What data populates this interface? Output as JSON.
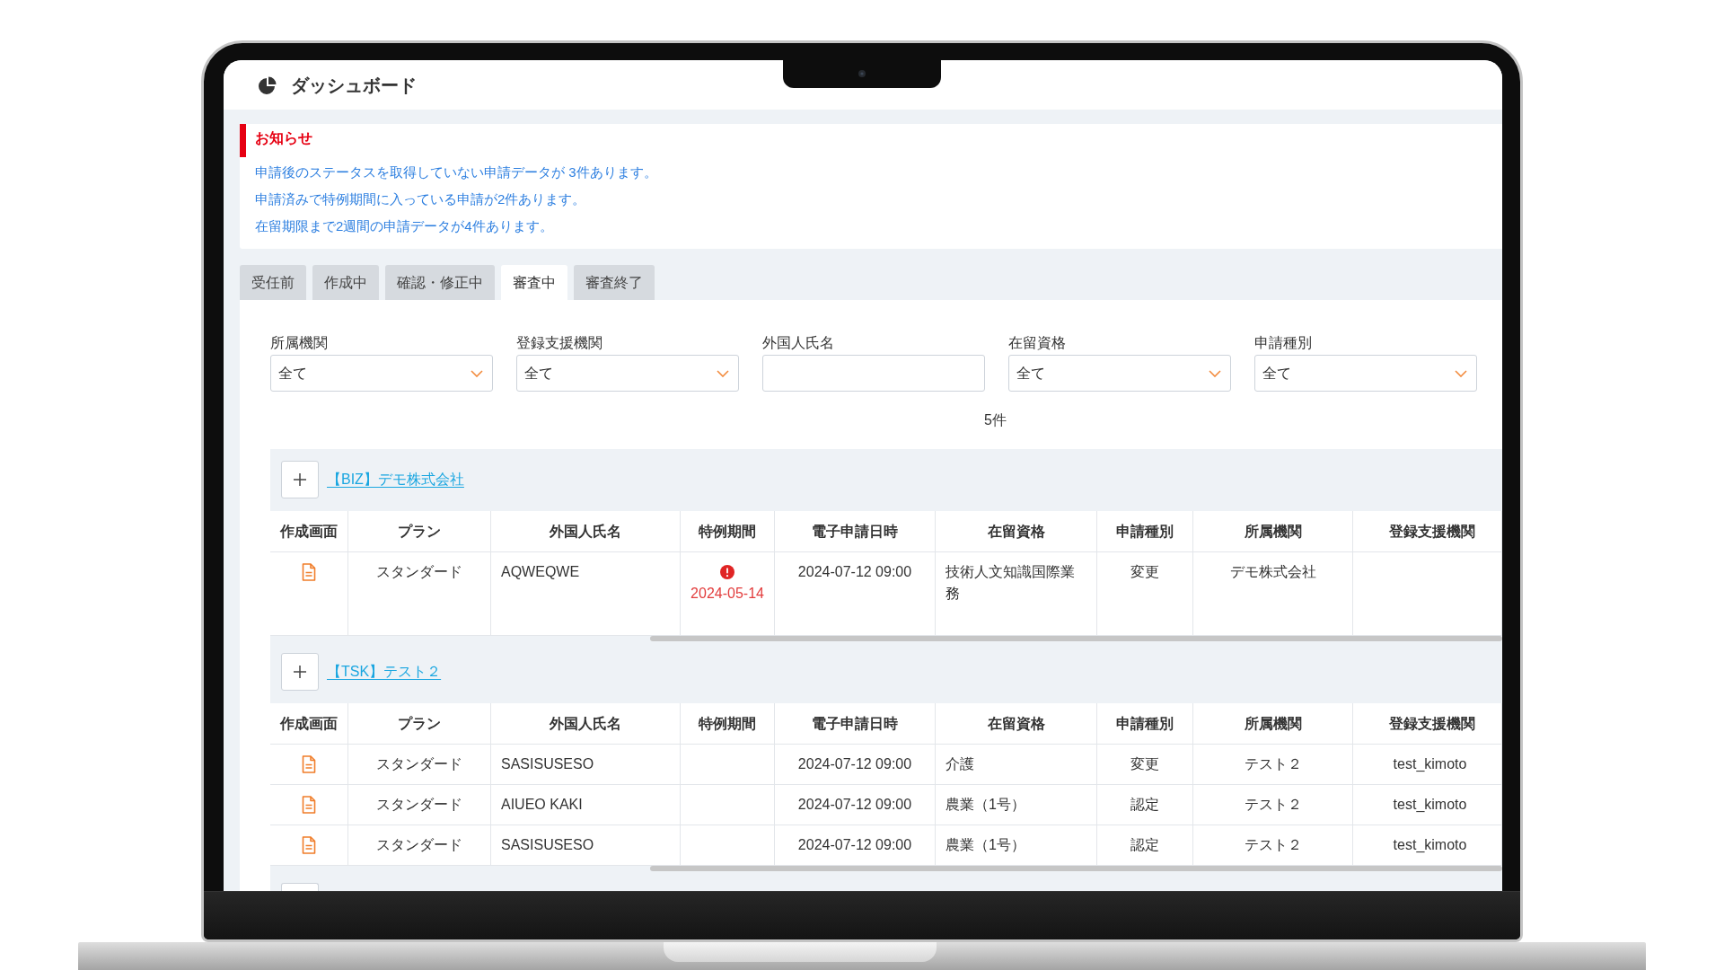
{
  "header": {
    "title": "ダッシュボード"
  },
  "notice": {
    "title": "お知らせ",
    "messages": [
      "申請後のステータスを取得していない申請データが 3件あります。",
      "申請済みで特例期間に入っている申請が2件あります。",
      "在留期限まで2週間の申請データが4件あります。"
    ]
  },
  "tabs": [
    {
      "label": "受任前",
      "selected": false
    },
    {
      "label": "作成中",
      "selected": false
    },
    {
      "label": "確認・修正中",
      "selected": false
    },
    {
      "label": "審査中",
      "selected": true
    },
    {
      "label": "審査終了",
      "selected": false
    }
  ],
  "filters": [
    {
      "kind": "select",
      "label": "所属機関",
      "value": "全て"
    },
    {
      "kind": "select",
      "label": "登録支援機関",
      "value": "全て"
    },
    {
      "kind": "text",
      "label": "外国人氏名"
    },
    {
      "kind": "select",
      "label": "在留資格",
      "value": "全て"
    },
    {
      "kind": "select",
      "label": "申請種別",
      "value": "全て"
    }
  ],
  "result_count": "5件",
  "groups": [
    {
      "title": "【BIZ】デモ株式会社",
      "columns": [
        "作成画面",
        "プラン",
        "外国人氏名",
        "特例期間",
        "電子申請日時",
        "在留資格",
        "申請種別",
        "所属機関",
        "登録支援機関"
      ],
      "rows": [
        {
          "plan": "スタンダード",
          "name": "AQWEQWE",
          "special_period": "2024-05-14",
          "submitted_at": "2024-07-12 09:00",
          "status": "技術人文知識国際業務",
          "application_type": "変更",
          "organization": "デモ株式会社"
        }
      ]
    },
    {
      "title": "【TSK】テスト２",
      "columns": [
        "作成画面",
        "プラン",
        "外国人氏名",
        "特例期間",
        "電子申請日時",
        "在留資格",
        "申請種別",
        "所属機関",
        "登録支援機関"
      ],
      "rows": [
        {
          "plan": "スタンダード",
          "name": "SASISUSESO",
          "submitted_at": "2024-07-12 09:00",
          "status": "介護",
          "application_type": "変更",
          "organization": "テスト２",
          "support_org": "test_kimoto"
        },
        {
          "plan": "スタンダード",
          "name": "AIUEO KAKI",
          "submitted_at": "2024-07-12 09:00",
          "status": "農業（1号）",
          "application_type": "認定",
          "organization": "テスト２",
          "support_org": "test_kimoto"
        },
        {
          "plan": "スタンダード",
          "name": "SASISUSESO",
          "submitted_at": "2024-07-12 09:00",
          "status": "農業（1号）",
          "application_type": "認定",
          "organization": "テスト２",
          "support_org": "test_kimoto"
        }
      ]
    }
  ]
}
